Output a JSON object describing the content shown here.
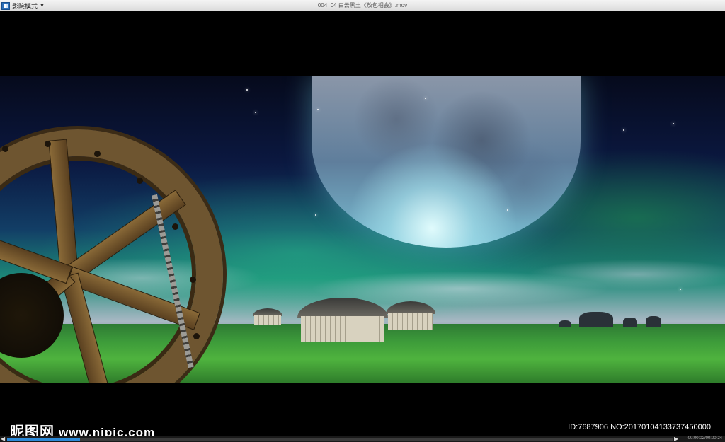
{
  "titlebar": {
    "menu_label": "影院模式",
    "file_title": "004_04 白云黑土《敖包相会》.mov"
  },
  "player": {
    "progress_fraction": 0.11,
    "time_display": "00:00:02/00:00:24"
  },
  "watermark": {
    "brand": "昵图网",
    "url": "www.nipic.com",
    "id_text": "ID:7687906 NO:20170104133737450000"
  },
  "icons": {
    "app": "app-icon",
    "menu_dropdown": "chevron-down-icon",
    "prev": "rewind-icon",
    "next": "forward-icon"
  }
}
